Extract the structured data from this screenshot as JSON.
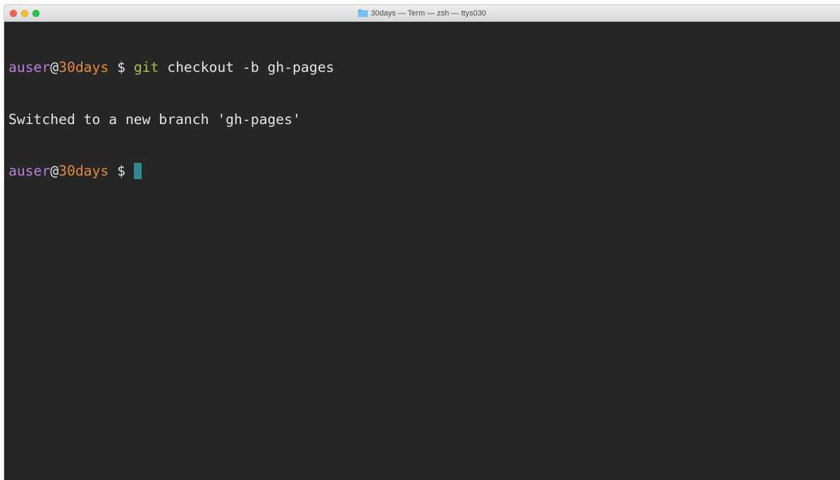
{
  "window": {
    "title": "30days — Term — zsh — ttys030",
    "title_icon": "folder-icon"
  },
  "terminal": {
    "lines": [
      {
        "user": "auser",
        "at": "@",
        "host": "30days",
        "dollar": " $ ",
        "command": "git",
        "args": " checkout -b gh-pages"
      },
      {
        "output": "Switched to a new branch 'gh-pages'"
      },
      {
        "user": "auser",
        "at": "@",
        "host": "30days",
        "dollar": " $ "
      }
    ]
  },
  "colors": {
    "background": "#262626",
    "user": "#bd7ddd",
    "host": "#e6893a",
    "command": "#a9c24b",
    "text": "#e6e6e6",
    "cursor": "#2f8a93"
  }
}
